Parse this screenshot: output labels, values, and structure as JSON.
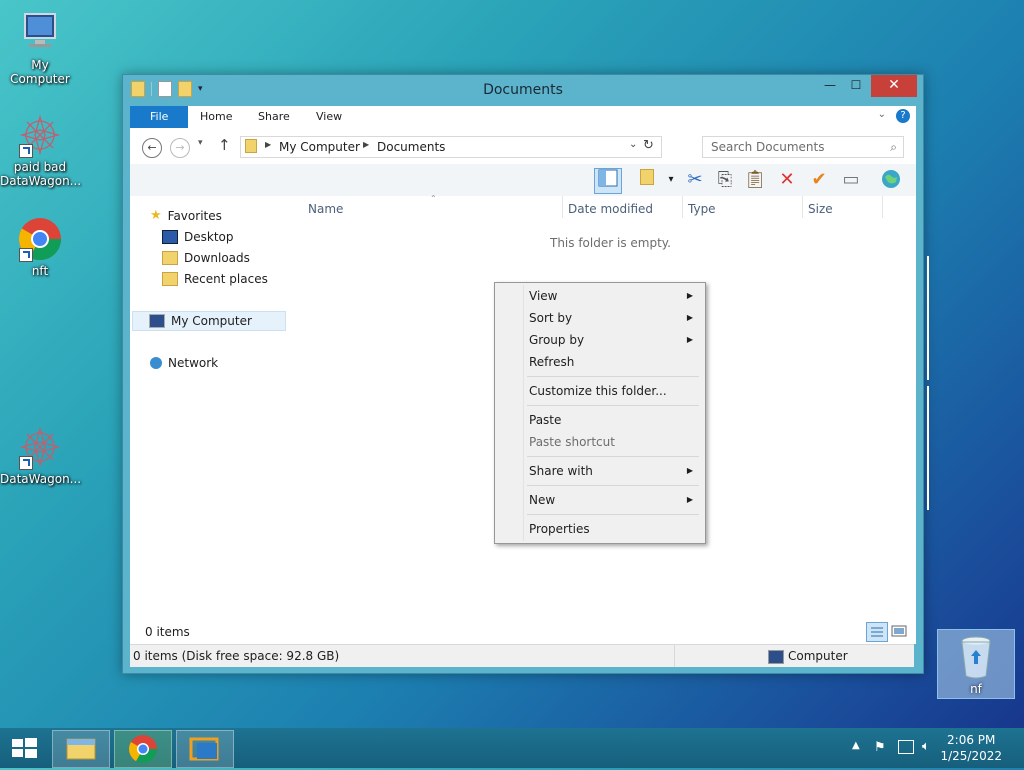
{
  "desktop": {
    "icons": [
      {
        "label": "My Computer"
      },
      {
        "label": "paid bad DataWagon..."
      },
      {
        "label": "nft"
      },
      {
        "label": "DataWagon..."
      }
    ],
    "recycle_label": "nf"
  },
  "window": {
    "title": "Documents",
    "controls": {
      "minimize": "—",
      "maximize": "☐",
      "close": "✕"
    },
    "ribbon_tabs": [
      "File",
      "Home",
      "Share",
      "View"
    ],
    "address": {
      "crumbs": [
        "My Computer",
        "Documents"
      ]
    },
    "search": {
      "placeholder": "Search Documents"
    },
    "navpane": {
      "favorites": "Favorites",
      "desktop": "Desktop",
      "downloads": "Downloads",
      "recent": "Recent places",
      "computer": "My Computer",
      "network": "Network"
    },
    "columns": [
      "Name",
      "Date modified",
      "Type",
      "Size"
    ],
    "empty_text": "This folder is empty.",
    "item_count": "0 items",
    "status_left": "0 items (Disk free space: 92.8 GB)",
    "status_right": "Computer"
  },
  "context_menu": {
    "items": [
      {
        "label": "View",
        "submenu": true
      },
      {
        "label": "Sort by",
        "submenu": true
      },
      {
        "label": "Group by",
        "submenu": true
      },
      {
        "label": "Refresh",
        "submenu": false
      },
      {
        "label": "Customize this folder...",
        "submenu": false
      },
      {
        "label": "Paste",
        "submenu": false
      },
      {
        "label": "Paste shortcut",
        "submenu": false,
        "disabled": true
      },
      {
        "label": "Share with",
        "submenu": true
      },
      {
        "label": "New",
        "submenu": true
      },
      {
        "label": "Properties",
        "submenu": false
      }
    ]
  },
  "taskbar": {
    "time": "2:06 PM",
    "date": "1/25/2022"
  }
}
